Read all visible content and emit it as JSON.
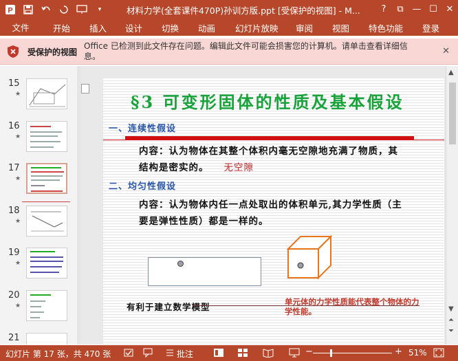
{
  "title_bar": {
    "document_title": "材料力学(全套课件470P)孙训方版.ppt [受保护的视图] - M...",
    "help_glyph": "?",
    "restore_glyph": "⧉",
    "minimize_glyph": "—",
    "maximize_glyph": "☐",
    "close_glyph": "✕"
  },
  "ribbon": {
    "file": "文件",
    "tabs": [
      "开始",
      "插入",
      "设计",
      "切换",
      "动画",
      "幻灯片放映",
      "审阅",
      "视图",
      "特色功能",
      "登录"
    ]
  },
  "protected_view": {
    "label": "受保护的视图",
    "message": "Office 已检测到此文件存在问题。编辑此文件可能会损害您的计算机。请单击查看详细信息。",
    "close_glyph": "✕"
  },
  "thumbnails": [
    {
      "num": "15",
      "star": "★"
    },
    {
      "num": "16",
      "star": "★"
    },
    {
      "num": "17",
      "star": "★"
    },
    {
      "num": "18",
      "star": "★"
    },
    {
      "num": "19",
      "star": "★"
    },
    {
      "num": "20",
      "star": "★"
    },
    {
      "num": "21",
      "star": ""
    }
  ],
  "slide": {
    "title": "§3 可变形固体的性质及基本假设",
    "section1": "一、连续性假设",
    "para1_line1": "内容：认为物体在其整个体积内毫无空隙地充满了物质，其",
    "para1_line2": "结构是密实的。",
    "note_no_gap": "无空隙",
    "section2": "二、均匀性假设",
    "para2_line1": "内容：认为物体内任一点处取出的体积单元,其力学性质（主",
    "para2_line2": "要是弹性性质）都是一样的。",
    "bottom_left": "有利于建立数学模型",
    "bottom_right": "单元体的力学性质能代表整个物体的力学性能。"
  },
  "status_bar": {
    "slide_info": "幻灯片 第 17 张，共 470 张",
    "notes": "批注",
    "zoom": "51%",
    "zoom_level": 0.51
  },
  "colors": {
    "brand": "#b7472a",
    "slide_title": "#18a33a",
    "section_heading": "#2855a5",
    "accent_red": "#d01010",
    "cube_orange": "#e8741c"
  }
}
